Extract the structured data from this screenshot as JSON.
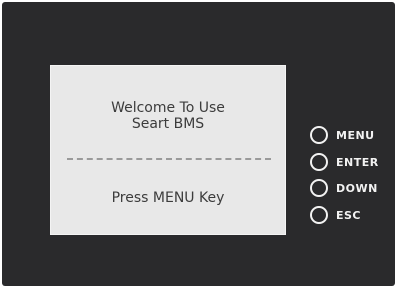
{
  "display": {
    "line1": "Welcome To Use",
    "line2": "Seart BMS",
    "separator": "----------------------------",
    "prompt": "Press MENU Key"
  },
  "keys": [
    {
      "label": "MENU"
    },
    {
      "label": "ENTER"
    },
    {
      "label": "DOWN"
    },
    {
      "label": "ESC"
    }
  ],
  "colors": {
    "panel": "#2a2a2c",
    "screen": "#e8e8e8",
    "screen_text": "#3c3c3c",
    "key_outline": "#f2f2f2"
  }
}
